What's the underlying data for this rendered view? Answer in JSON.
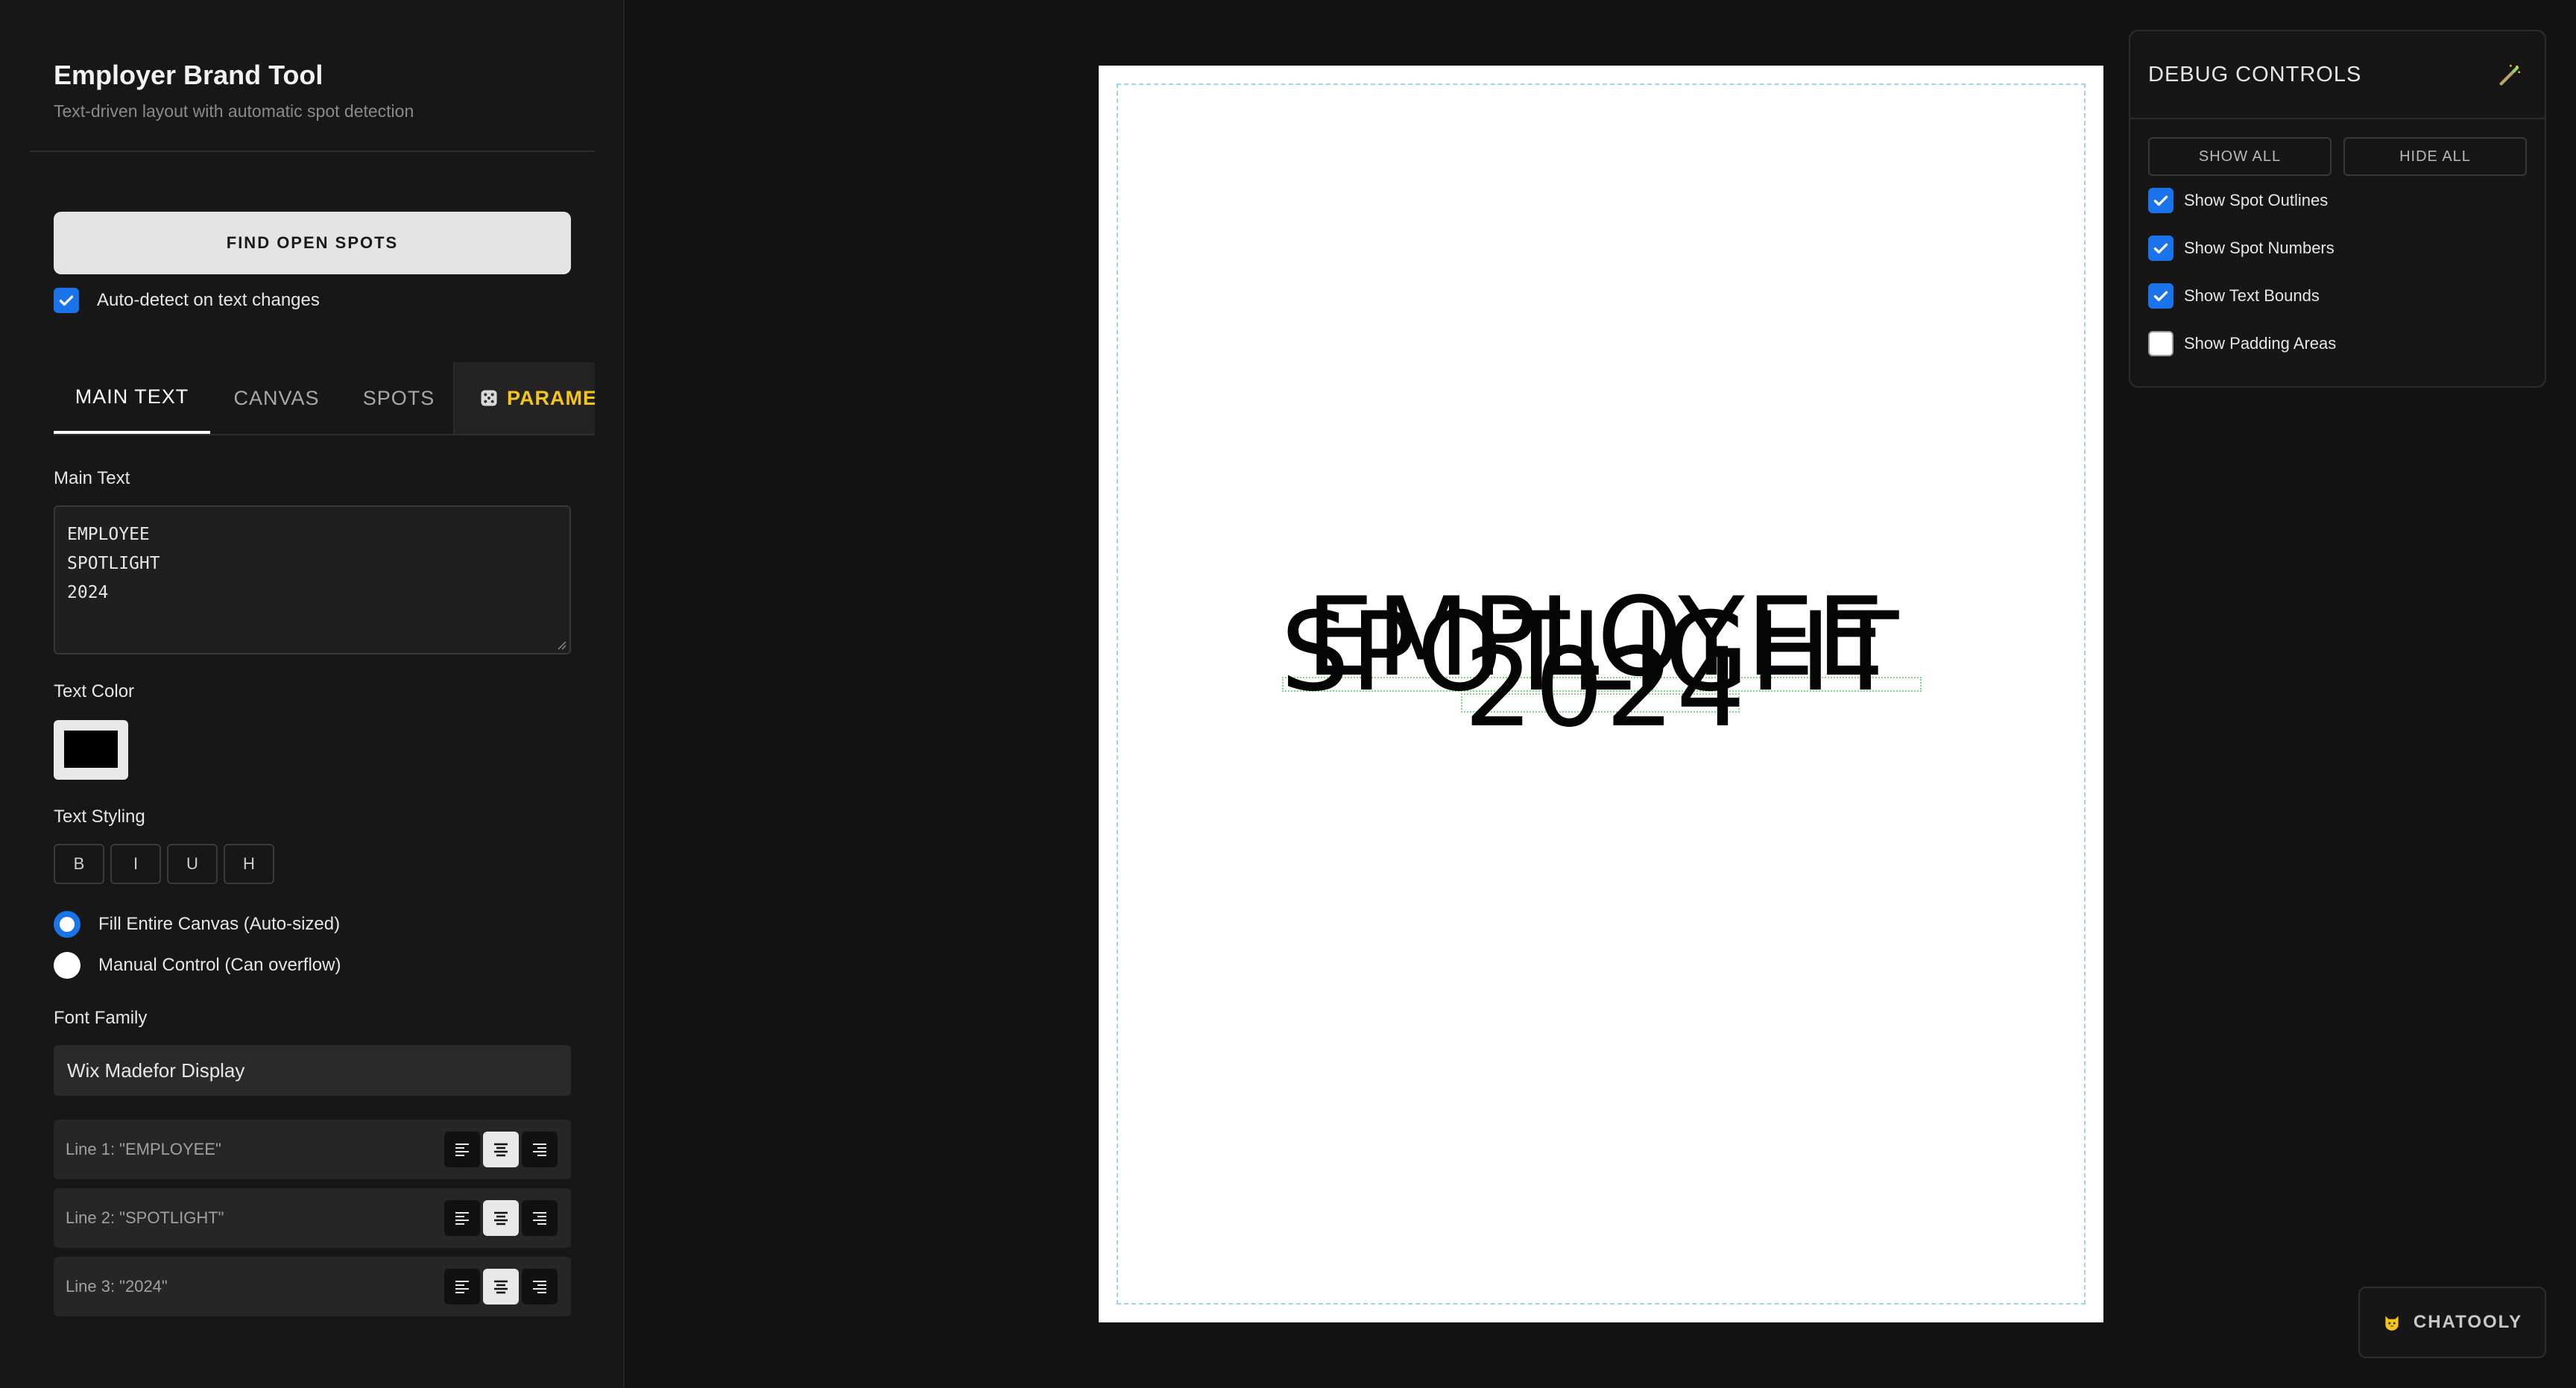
{
  "app": {
    "title": "Employer Brand Tool",
    "subtitle": "Text-driven layout with automatic spot detection"
  },
  "actions": {
    "find_spots_label": "FIND OPEN SPOTS",
    "auto_detect_label": "Auto-detect on text changes",
    "auto_detect_checked": true
  },
  "tabs": [
    {
      "label": "MAIN TEXT",
      "active": true
    },
    {
      "label": "CANVAS",
      "active": false
    },
    {
      "label": "SPOTS",
      "active": false
    },
    {
      "label": "PARAMETERS",
      "active": false,
      "icon": "dice-icon"
    }
  ],
  "main_text": {
    "label": "Main Text",
    "lines": [
      "EMPLOYEE",
      "SPOTLIGHT",
      "2024"
    ]
  },
  "text_color": {
    "label": "Text Color",
    "value": "#000000"
  },
  "text_styling": {
    "label": "Text Styling",
    "buttons": [
      "B",
      "I",
      "U",
      "H"
    ]
  },
  "sizing": {
    "options": [
      {
        "label": "Fill Entire Canvas (Auto-sized)",
        "selected": true
      },
      {
        "label": "Manual Control (Can overflow)",
        "selected": false
      }
    ]
  },
  "font_family": {
    "label": "Font Family",
    "value": "Wix Madefor Display"
  },
  "line_alignments": [
    {
      "label": "Line 1: \"EMPLOYEE\"",
      "align": "center"
    },
    {
      "label": "Line 2: \"SPOTLIGHT\"",
      "align": "center"
    },
    {
      "label": "Line 3: \"2024\"",
      "align": "center"
    }
  ],
  "canvas": {
    "background": "#ffffff",
    "text_color": "#000000",
    "lines": [
      "EMPLOYEE",
      "SPOTLIGHT",
      "2024"
    ]
  },
  "debug": {
    "title": "DEBUG CONTROLS",
    "icon": "wand-icon",
    "show_all_label": "SHOW ALL",
    "hide_all_label": "HIDE ALL",
    "options": [
      {
        "label": "Show Spot Outlines",
        "checked": true
      },
      {
        "label": "Show Spot Numbers",
        "checked": true
      },
      {
        "label": "Show Text Bounds",
        "checked": true
      },
      {
        "label": "Show Padding Areas",
        "checked": false
      }
    ]
  },
  "chat": {
    "label": "CHATOOLY",
    "icon": "cat-icon"
  },
  "colors": {
    "accent": "#1a73e8",
    "params_tab": "#f5c518",
    "padding_outline": "#9fd3ea",
    "text_bounds": "#7ed87e"
  }
}
